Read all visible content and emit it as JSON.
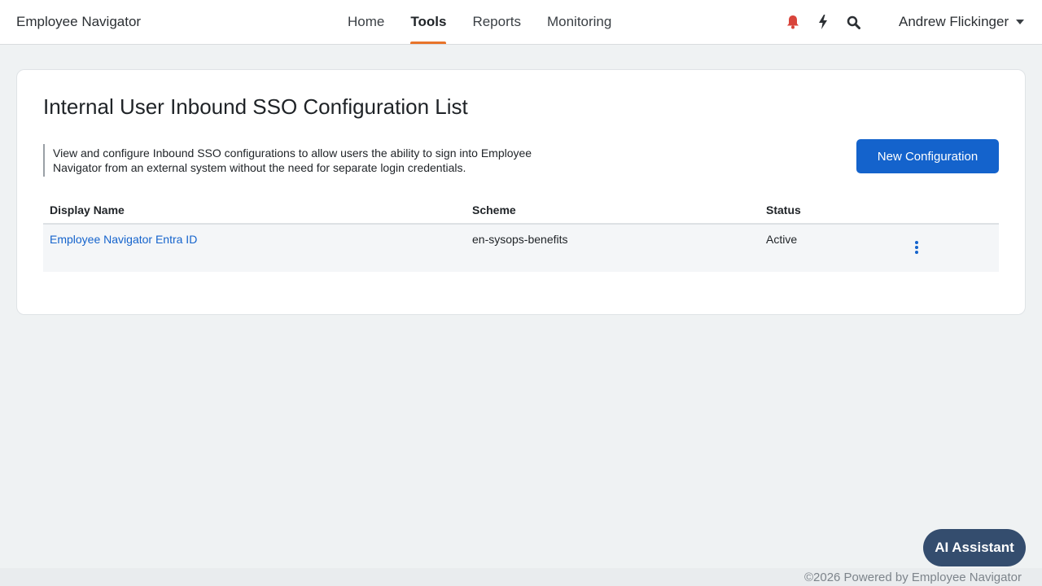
{
  "app": {
    "brand": "Employee Navigator"
  },
  "nav": {
    "links": [
      {
        "label": "Home",
        "active": false
      },
      {
        "label": "Tools",
        "active": true
      },
      {
        "label": "Reports",
        "active": false
      },
      {
        "label": "Monitoring",
        "active": false
      }
    ],
    "icons": [
      "bell-icon",
      "lightning-icon",
      "search-icon"
    ],
    "user_name": "Andrew Flickinger"
  },
  "page": {
    "title": "Internal User Inbound SSO Configuration List",
    "description": "View and configure Inbound SSO configurations to allow users the ability to sign into Employee Navigator from an external system without the need for separate login credentials.",
    "new_button": "New Configuration"
  },
  "table": {
    "headers": [
      "Display Name",
      "Scheme",
      "Status",
      ""
    ],
    "rows": [
      {
        "display_name": "Employee Navigator Entra ID",
        "scheme": "en-sysops-benefits",
        "status": "Active"
      }
    ]
  },
  "footer": {
    "ai_button": "AI Assistant",
    "copyright": "©2026 Powered by Employee Navigator"
  },
  "colors": {
    "accent": "#1463cc",
    "active_tab_underline": "#e8742a",
    "bell": "#d9443b",
    "ai_button": "#344d6e"
  }
}
